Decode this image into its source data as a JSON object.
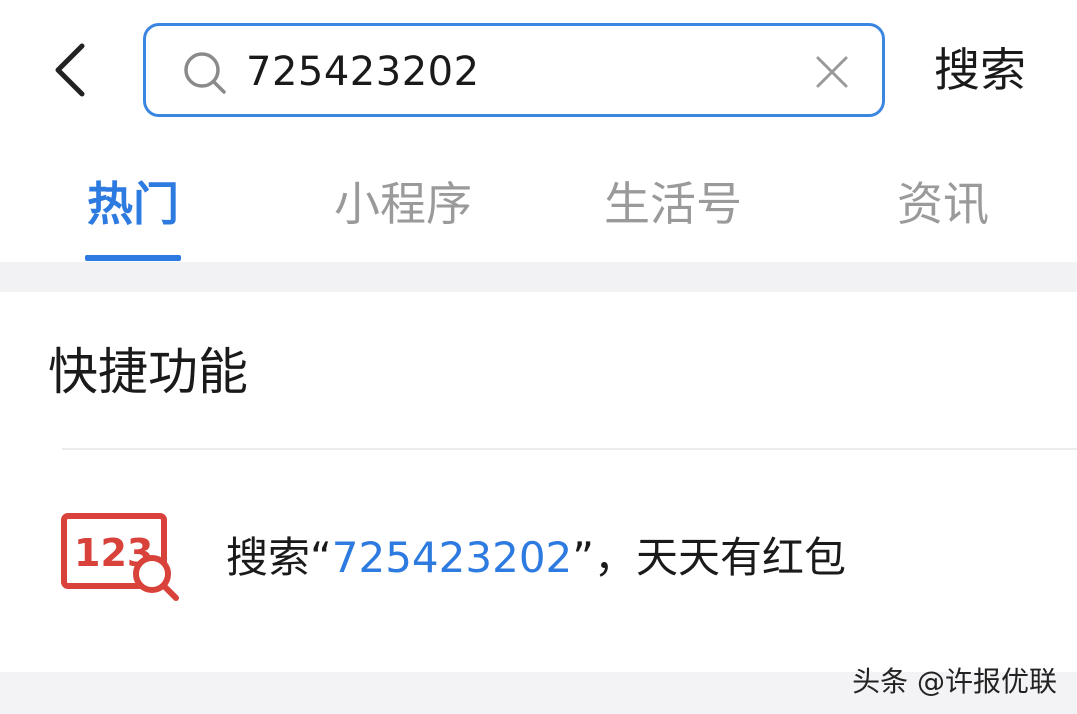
{
  "header": {
    "search": {
      "value": "725423202"
    },
    "search_action_label": "搜索"
  },
  "tabs": [
    {
      "label": "热门",
      "active": true
    },
    {
      "label": "小程序",
      "active": false
    },
    {
      "label": "生活号",
      "active": false
    },
    {
      "label": "资讯",
      "active": false
    }
  ],
  "section": {
    "title": "快捷功能",
    "item": {
      "icon": "123-search-icon",
      "prefix": "搜索“",
      "highlight": "725423202",
      "suffix": "”，天天有红包"
    }
  },
  "watermark": "头条 @许报优联",
  "colors": {
    "accent": "#2d7ae0",
    "border": "#3b86e0",
    "icon_red": "#d9423a"
  }
}
